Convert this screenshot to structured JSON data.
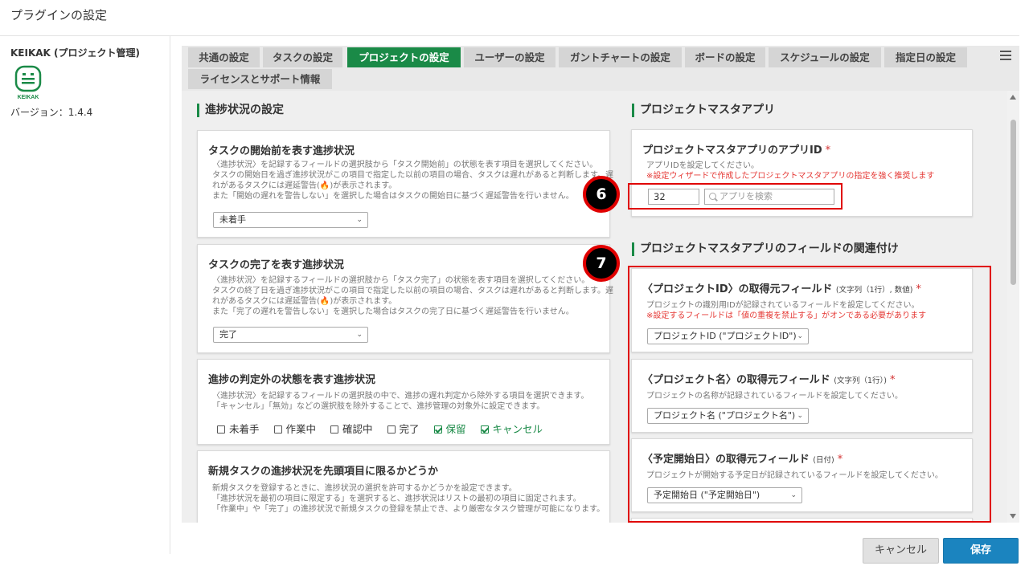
{
  "page_title": "プラグインの設定",
  "plugin": {
    "name": "KEIKAK (プロジェクト管理)",
    "logo_text": "KEIKAK",
    "version": "バージョン：1.4.4"
  },
  "tabs": [
    {
      "label": "共通の設定"
    },
    {
      "label": "タスクの設定"
    },
    {
      "label": "プロジェクトの設定",
      "active": true
    },
    {
      "label": "ユーザーの設定"
    },
    {
      "label": "ガントチャートの設定"
    },
    {
      "label": "ボードの設定"
    },
    {
      "label": "スケジュールの設定"
    },
    {
      "label": "指定日の設定"
    },
    {
      "label": "ライセンスとサポート情報"
    }
  ],
  "left_section": {
    "title": "進捗状況の設定",
    "cards": [
      {
        "title": "タスクの開始前を表す進捗状況",
        "desc": [
          "〈進捗状況〉を記録するフィールドの選択肢から「タスク開始前」の状態を表す項目を選択してください。",
          "タスクの開始日を過ぎ進捗状況がこの項目で指定した以前の項目の場合、タスクは遅れがあると判断します。遅",
          "れがあるタスクには遅延警告(🔥)が表示されます。",
          "また「開始の遅れを警告しない」を選択した場合はタスクの開始日に基づく遅延警告を行いません。"
        ],
        "select": "未着手"
      },
      {
        "title": "タスクの完了を表す進捗状況",
        "desc": [
          "〈進捗状況〉を記録するフィールドの選択肢から「タスク完了」の状態を表す項目を選択してください。",
          "タスクの終了日を過ぎ進捗状況がこの項目で指定した以前の項目の場合、タスクは遅れがあると判断します。遅",
          "れがあるタスクには遅延警告(🔥)が表示されます。",
          "また「完了の遅れを警告しない」を選択した場合はタスクの完了日に基づく遅延警告を行いません。"
        ],
        "select": "完了"
      },
      {
        "title": "進捗の判定外の状態を表す進捗状況",
        "desc": [
          "〈進捗状況〉を記録するフィールドの選択肢の中で、進捗の遅れ判定から除外する項目を選択できます。",
          "「キャンセル」「無効」などの選択肢を除外することで、進捗管理の対象外に設定できます。"
        ],
        "checks": [
          {
            "label": "未着手",
            "checked": false
          },
          {
            "label": "作業中",
            "checked": false
          },
          {
            "label": "確認中",
            "checked": false
          },
          {
            "label": "完了",
            "checked": false
          },
          {
            "label": "保留",
            "checked": true
          },
          {
            "label": "キャンセル",
            "checked": true
          }
        ]
      },
      {
        "title": "新規タスクの進捗状況を先頭項目に限るかどうか",
        "desc": [
          "新規タスクを登録するときに、進捗状況の選択を許可するかどうかを設定できます。",
          "「進捗状況を最初の項目に限定する」を選択すると、進捗状況はリストの最初の項目に固定されます。",
          "「作業中」や「完了」の進捗状況で新規タスクの登録を禁止でき、より厳密なタスク管理が可能になります。"
        ]
      }
    ]
  },
  "right_section": {
    "title1": "プロジェクトマスタアプリ",
    "app_card": {
      "title": "プロジェクトマスタアプリのアプリID",
      "required_mark": "*",
      "desc": "アプリIDを設定してください。",
      "warn": "※設定ウィザードで作成したプロジェクトマスタアプリの指定を強く推奨します",
      "app_id_value": "32",
      "search_placeholder": "アプリを検索"
    },
    "title2": "プロジェクトマスタアプリのフィールドの関連付け",
    "field_cards": [
      {
        "title": "〈プロジェクトID〉の取得元フィールド",
        "type_note": "(文字列（1行）, 数値)",
        "required_mark": "*",
        "desc": "プロジェクトの識別用IDが記録されているフィールドを設定してください。",
        "warn": "※設定するフィールドは「値の重複を禁止する」がオンである必要があります",
        "select": "プロジェクトID (\"プロジェクトID\")"
      },
      {
        "title": "〈プロジェクト名〉の取得元フィールド",
        "type_note": "(文字列（1行）)",
        "required_mark": "*",
        "desc": "プロジェクトの名称が記録されているフィールドを設定してください。",
        "select": "プロジェクト名 (\"プロジェクト名\")"
      },
      {
        "title": "〈予定開始日〉の取得元フィールド",
        "type_note": "(日付)",
        "required_mark": "*",
        "desc": "プロジェクトが開始する予定日が記録されているフィールドを設定してください。",
        "select": "予定開始日 (\"予定開始日\")"
      }
    ]
  },
  "markers": [
    "6",
    "7"
  ],
  "colors": {
    "accent": "#1a8a47",
    "save": "#1b84bf",
    "annotation": "#e00000"
  },
  "buttons": {
    "cancel": "キャンセル",
    "save": "保存"
  }
}
